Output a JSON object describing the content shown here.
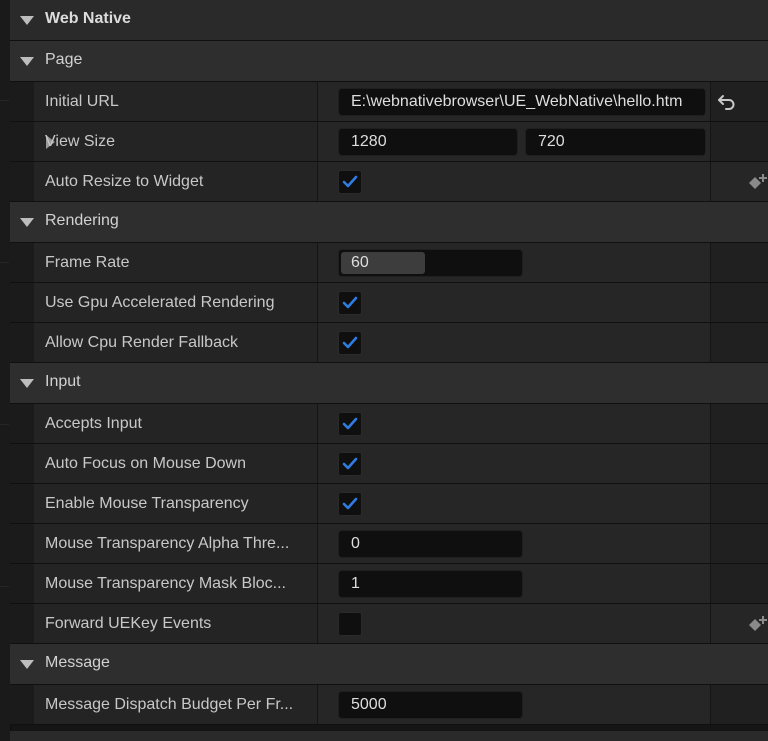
{
  "categories": {
    "web_native": "Web Native",
    "page": "Page",
    "rendering": "Rendering",
    "input": "Input",
    "message": "Message"
  },
  "page": {
    "initial_url_label": "Initial URL",
    "initial_url_value": "E:\\webnativebrowser\\UE_WebNative\\hello.htm",
    "view_size_label": "View Size",
    "view_size_x": "1280",
    "view_size_y": "720",
    "auto_resize_label": "Auto Resize to Widget",
    "auto_resize_checked": true
  },
  "rendering": {
    "frame_rate_label": "Frame Rate",
    "frame_rate_value": "60",
    "frame_rate_fill_fraction": 0.47,
    "gpu_label": "Use Gpu Accelerated Rendering",
    "gpu_checked": true,
    "cpu_fallback_label": "Allow Cpu Render Fallback",
    "cpu_fallback_checked": true
  },
  "input": {
    "accepts_input_label": "Accepts Input",
    "accepts_input_checked": true,
    "auto_focus_label": "Auto Focus on Mouse Down",
    "auto_focus_checked": true,
    "mouse_transparency_label": "Enable Mouse Transparency",
    "mouse_transparency_checked": true,
    "alpha_threshold_label": "Mouse Transparency Alpha Thre...",
    "alpha_threshold_value": "0",
    "mask_block_label": "Mouse Transparency Mask Bloc...",
    "mask_block_value": "1",
    "forward_uekey_label": "Forward UEKey Events",
    "forward_uekey_checked": false
  },
  "message": {
    "dispatch_budget_label": "Message Dispatch Budget Per Fr...",
    "dispatch_budget_value": "5000"
  },
  "colors": {
    "check_blue": "#2f7de0",
    "background": "#151515"
  },
  "icons": {
    "reset": "reset-to-default-icon",
    "keyframe": "add-keyframe-icon"
  }
}
